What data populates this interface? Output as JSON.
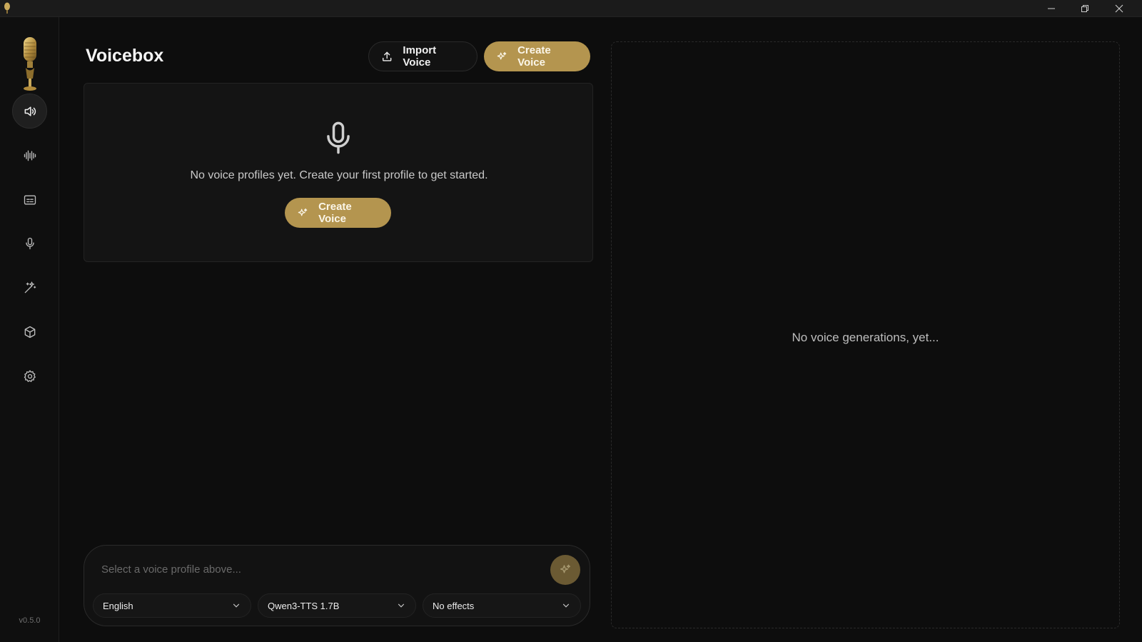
{
  "app": {
    "title": "Voicebox",
    "version": "v0.5.0"
  },
  "header": {
    "import_label": "Import Voice",
    "create_label": "Create Voice"
  },
  "profiles": {
    "empty_text": "No voice profiles yet. Create your first profile to get started.",
    "create_label": "Create Voice"
  },
  "composer": {
    "placeholder": "Select a voice profile above...",
    "language": "English",
    "model": "Qwen3-TTS 1.7B",
    "effects": "No effects"
  },
  "history": {
    "empty_text": "No voice generations, yet..."
  },
  "sidebar": {
    "items": [
      {
        "icon": "speaker-icon",
        "active": true
      },
      {
        "icon": "waveform-icon",
        "active": false
      },
      {
        "icon": "captions-icon",
        "active": false
      },
      {
        "icon": "microphone-icon",
        "active": false
      },
      {
        "icon": "magic-wand-icon",
        "active": false
      },
      {
        "icon": "package-icon",
        "active": false
      },
      {
        "icon": "settings-icon",
        "active": false
      }
    ]
  },
  "colors": {
    "accent": "#b4954f",
    "background": "#0d0d0d",
    "panel": "#141414"
  }
}
